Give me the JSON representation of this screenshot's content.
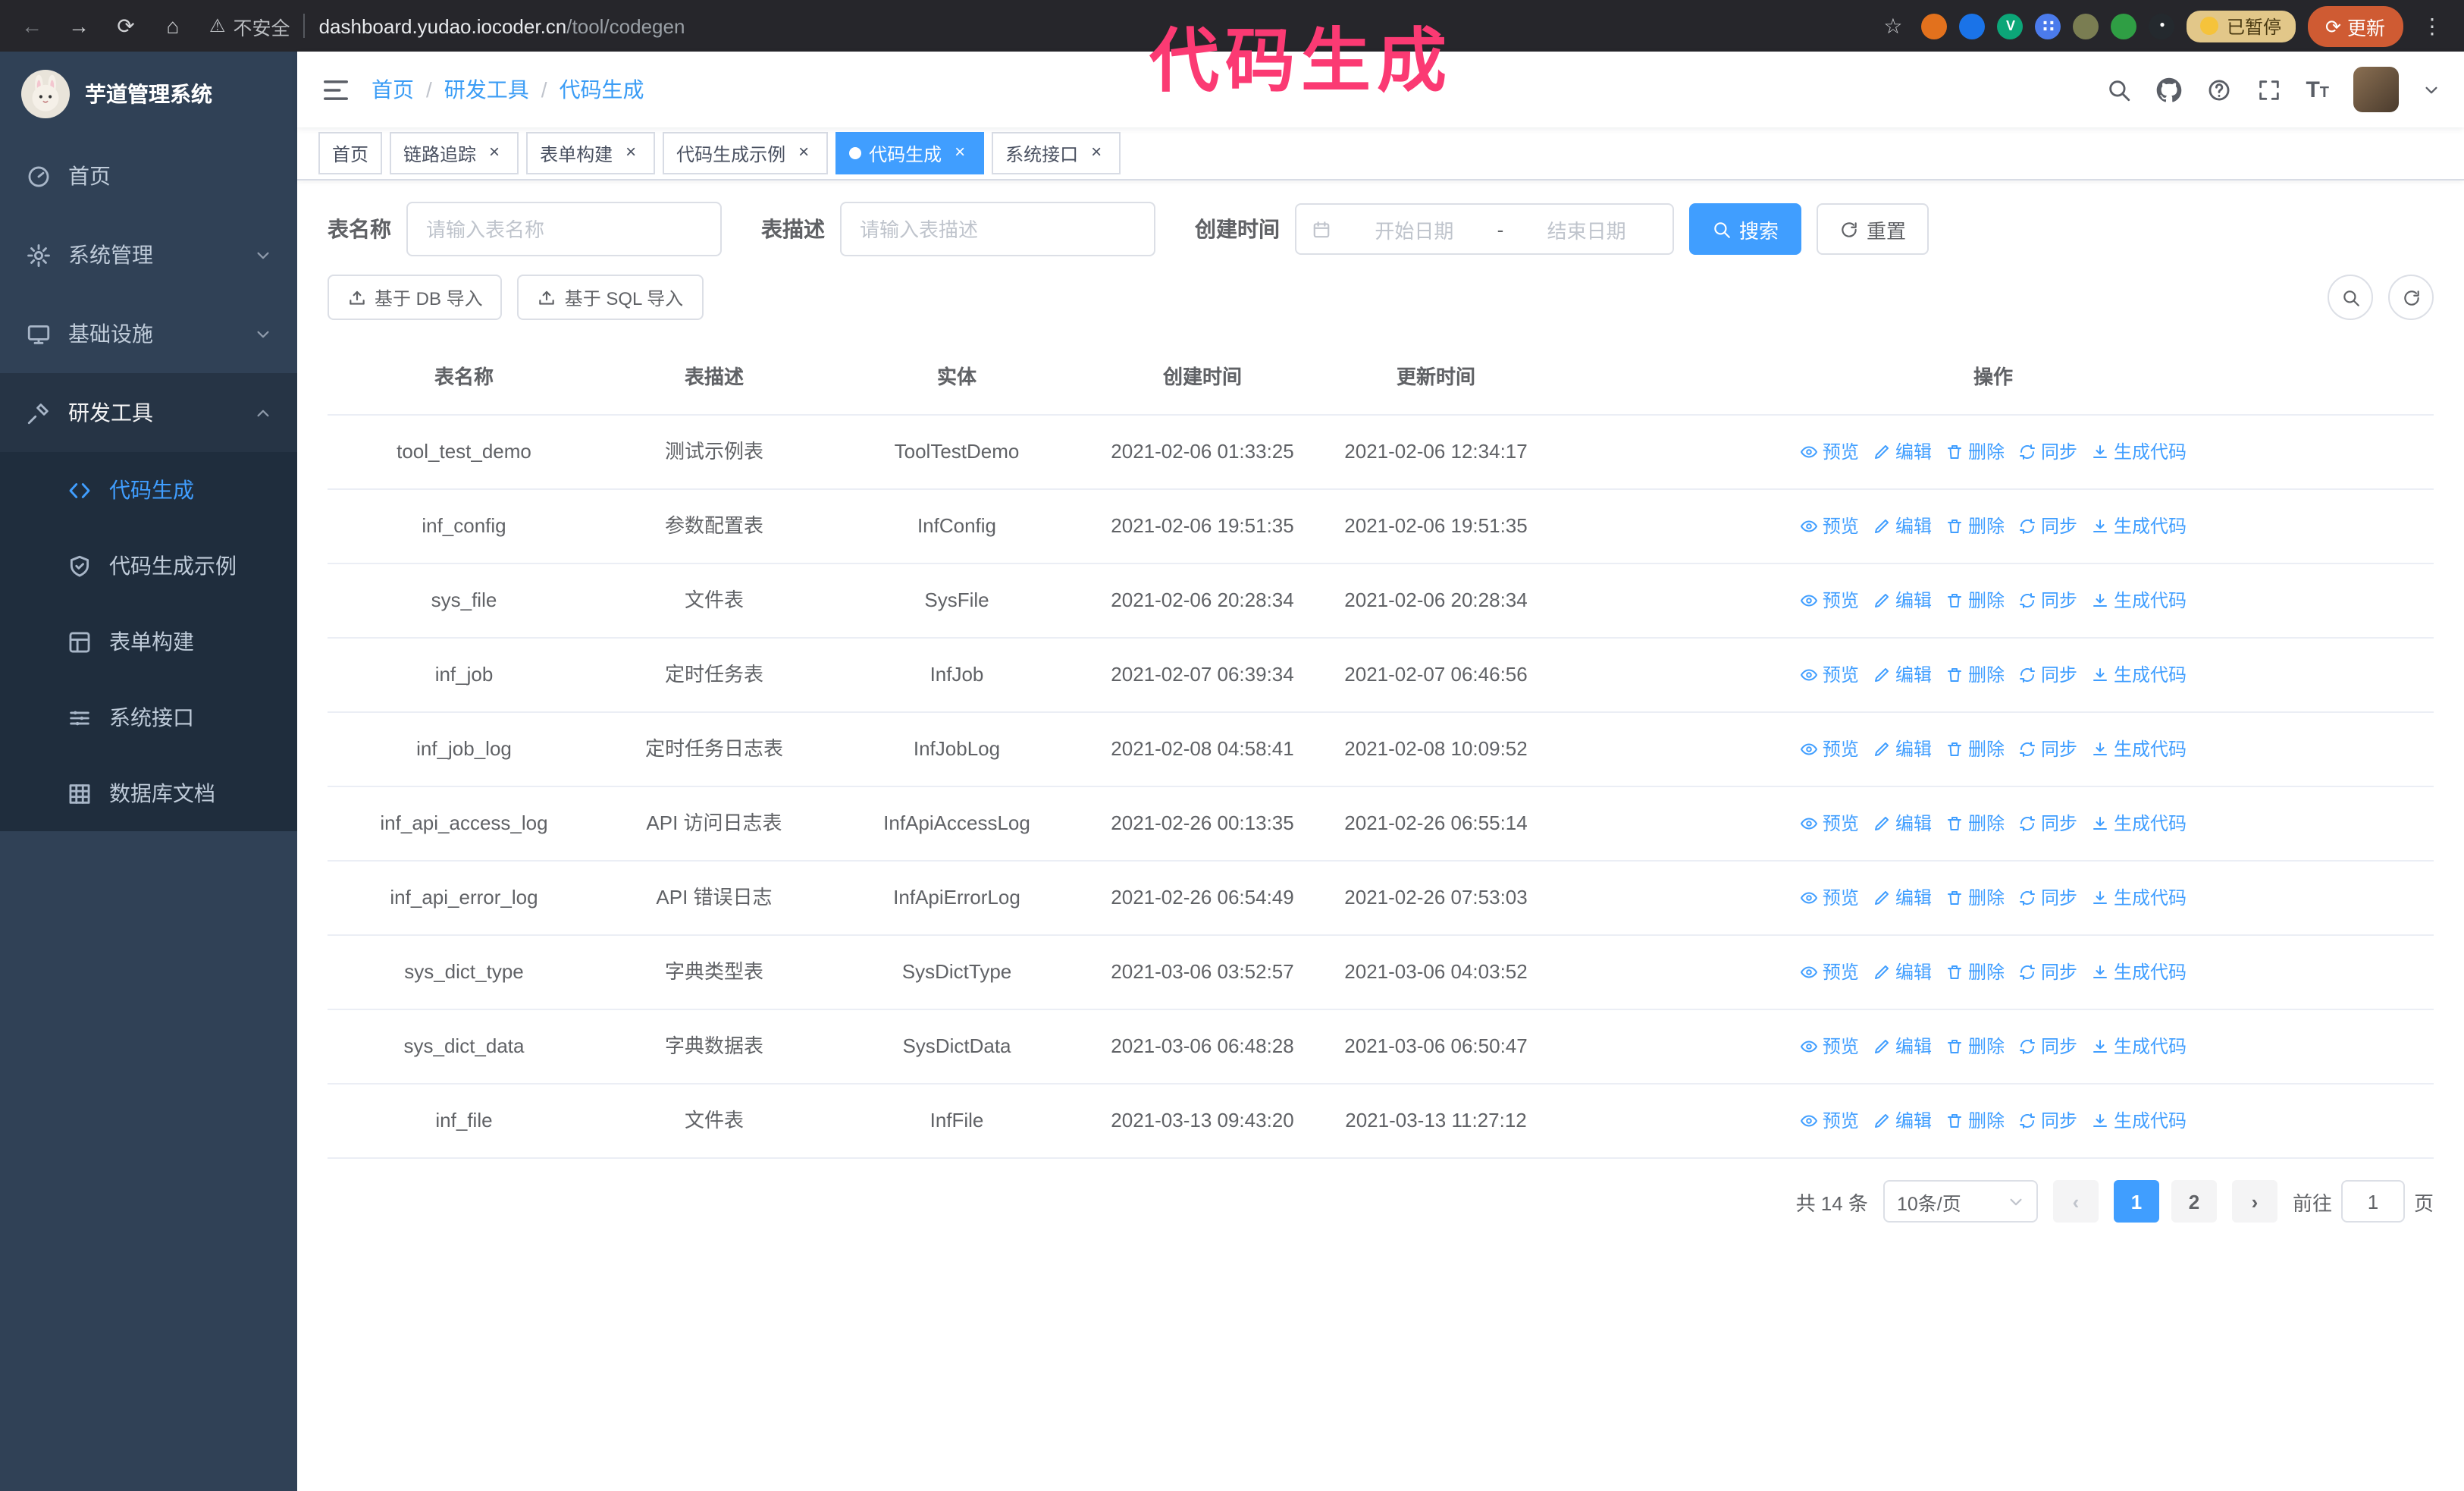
{
  "browser": {
    "security_warning": "不安全",
    "url_host": "dashboard.yudao.iocoder.cn",
    "url_path": "/tool/codegen",
    "paused_badge": "已暂停",
    "update_label": "更新"
  },
  "annotation": {
    "text": "代码生成",
    "color": "#fb3a73"
  },
  "sidebar": {
    "logo_title": "芋道管理系统",
    "menu": [
      {
        "label": "首页",
        "icon": "dashboard-icon",
        "expandable": false,
        "expanded": false
      },
      {
        "label": "系统管理",
        "icon": "gear-icon",
        "expandable": true,
        "expanded": false
      },
      {
        "label": "基础设施",
        "icon": "infrastructure-icon",
        "expandable": true,
        "expanded": false
      },
      {
        "label": "研发工具",
        "icon": "tools-icon",
        "expandable": true,
        "expanded": true
      }
    ],
    "submenu": [
      {
        "label": "代码生成",
        "icon": "code-icon",
        "active": true
      },
      {
        "label": "代码生成示例",
        "icon": "shield-check-icon",
        "active": false
      },
      {
        "label": "表单构建",
        "icon": "form-builder-icon",
        "active": false
      },
      {
        "label": "系统接口",
        "icon": "api-icon",
        "active": false
      },
      {
        "label": "数据库文档",
        "icon": "database-doc-icon",
        "active": false
      }
    ]
  },
  "navbar": {
    "separator": "/",
    "breadcrumb": [
      {
        "label": "首页"
      },
      {
        "label": "研发工具"
      },
      {
        "label": "代码生成"
      }
    ]
  },
  "tags": [
    {
      "label": "首页",
      "closable": false,
      "active": false
    },
    {
      "label": "链路追踪",
      "closable": true,
      "active": false
    },
    {
      "label": "表单构建",
      "closable": true,
      "active": false
    },
    {
      "label": "代码生成示例",
      "closable": true,
      "active": false
    },
    {
      "label": "代码生成",
      "closable": true,
      "active": true
    },
    {
      "label": "系统接口",
      "closable": true,
      "active": false
    }
  ],
  "filters": {
    "table_name_label": "表名称",
    "table_name_placeholder": "请输入表名称",
    "table_desc_label": "表描述",
    "table_desc_placeholder": "请输入表描述",
    "create_time_label": "创建时间",
    "date_start_placeholder": "开始日期",
    "date_separator": "-",
    "date_end_placeholder": "结束日期",
    "search_button": "搜索",
    "reset_button": "重置"
  },
  "toolbar": {
    "import_db": "基于 DB 导入",
    "import_sql": "基于 SQL 导入"
  },
  "table": {
    "columns": [
      "表名称",
      "表描述",
      "实体",
      "创建时间",
      "更新时间",
      "操作"
    ],
    "actions": [
      "预览",
      "编辑",
      "删除",
      "同步",
      "生成代码"
    ],
    "rows": [
      {
        "name": "tool_test_demo",
        "desc": "测试示例表",
        "entity": "ToolTestDemo",
        "created": "2021-02-06 01:33:25",
        "updated": "2021-02-06 12:34:17"
      },
      {
        "name": "inf_config",
        "desc": "参数配置表",
        "entity": "InfConfig",
        "created": "2021-02-06 19:51:35",
        "updated": "2021-02-06 19:51:35"
      },
      {
        "name": "sys_file",
        "desc": "文件表",
        "entity": "SysFile",
        "created": "2021-02-06 20:28:34",
        "updated": "2021-02-06 20:28:34"
      },
      {
        "name": "inf_job",
        "desc": "定时任务表",
        "entity": "InfJob",
        "created": "2021-02-07 06:39:34",
        "updated": "2021-02-07 06:46:56"
      },
      {
        "name": "inf_job_log",
        "desc": "定时任务日志表",
        "entity": "InfJobLog",
        "created": "2021-02-08 04:58:41",
        "updated": "2021-02-08 10:09:52"
      },
      {
        "name": "inf_api_access_log",
        "desc": "API 访问日志表",
        "entity": "InfApiAccessLog",
        "created": "2021-02-26 00:13:35",
        "updated": "2021-02-26 06:55:14"
      },
      {
        "name": "inf_api_error_log",
        "desc": "API 错误日志",
        "entity": "InfApiErrorLog",
        "created": "2021-02-26 06:54:49",
        "updated": "2021-02-26 07:53:03"
      },
      {
        "name": "sys_dict_type",
        "desc": "字典类型表",
        "entity": "SysDictType",
        "created": "2021-03-06 03:52:57",
        "updated": "2021-03-06 04:03:52"
      },
      {
        "name": "sys_dict_data",
        "desc": "字典数据表",
        "entity": "SysDictData",
        "created": "2021-03-06 06:48:28",
        "updated": "2021-03-06 06:50:47"
      },
      {
        "name": "inf_file",
        "desc": "文件表",
        "entity": "InfFile",
        "created": "2021-03-13 09:43:20",
        "updated": "2021-03-13 11:27:12"
      }
    ]
  },
  "pagination": {
    "total": "共 14 条",
    "page_size": "10条/页",
    "prev_label": "‹",
    "next_label": "›",
    "pages": [
      "1",
      "2"
    ],
    "active_page": "1",
    "goto_label": "前往",
    "goto_value": "1",
    "page_label": "页"
  },
  "colors": {
    "primary": "#409eff",
    "sidebar_bg": "#304156",
    "submenu_bg": "#1f2d3d"
  }
}
